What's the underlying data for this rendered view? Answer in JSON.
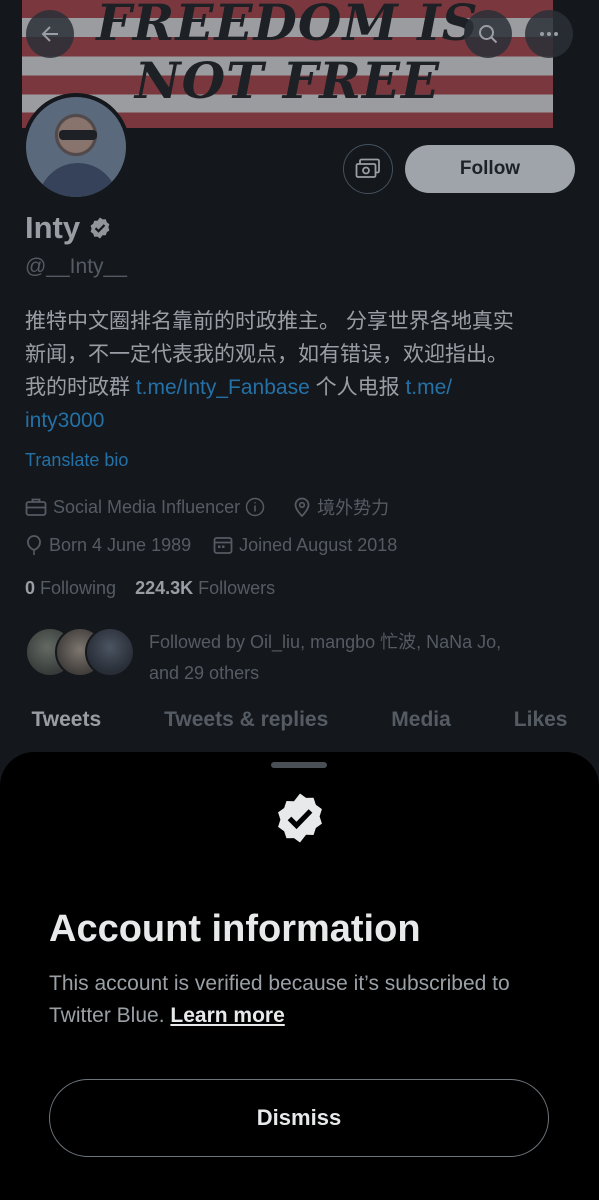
{
  "banner": {
    "line1": "FREEDOM IS",
    "line2": "NOT FREE"
  },
  "header_icons": {
    "back": "arrow-left-icon",
    "search": "search-icon",
    "more": "more-icon"
  },
  "profile": {
    "name": "Inty",
    "handle": "@__Inty__",
    "bio_line1": "推特中文圈排名靠前的时政推主。 分享世界各地真实",
    "bio_line2": "新闻，不一定代表我的观点，如有错误，欢迎指出。",
    "bio_line3_prefix": "我的时政群 ",
    "bio_link1": "t.me/Inty_Fanbase",
    "bio_line3_mid": " 个人电报 ",
    "bio_link2_a": "t.me/",
    "bio_link2_b": "inty3000",
    "translate": "Translate bio",
    "category": "Social Media Influencer",
    "location": "境外势力",
    "born": "Born 4 June 1989",
    "joined": "Joined August 2018",
    "following_count": "0",
    "following_label": "Following",
    "followers_count": "224.3K",
    "followers_label": "Followers",
    "followed_by_line1": "Followed by Oil_liu, mangbo 忙波, NaNa Jo,",
    "followed_by_line2": "and 29 others",
    "follow_button": "Follow"
  },
  "tabs": [
    "Tweets",
    "Tweets & replies",
    "Media",
    "Likes"
  ],
  "sheet": {
    "title": "Account information",
    "text": "This account is verified because it’s subscribed to Twitter Blue. ",
    "learn_more": "Learn more",
    "dismiss": "Dismiss"
  },
  "colors": {
    "link": "#1d9bf0",
    "background": "#000000"
  }
}
